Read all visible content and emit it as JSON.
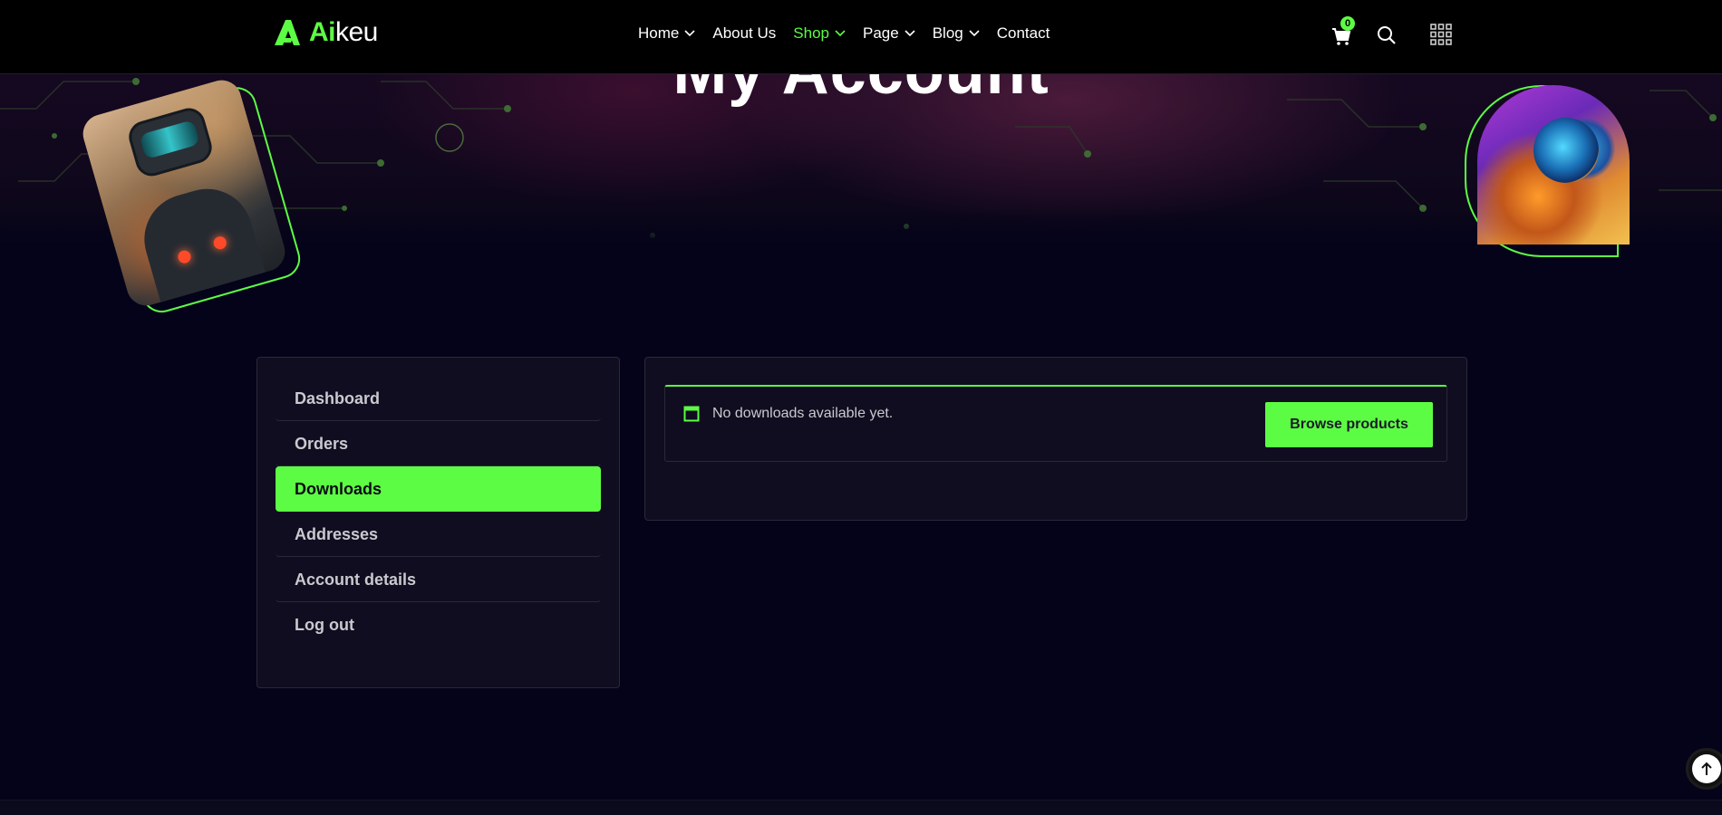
{
  "brand": {
    "logo_accent": "Ai",
    "logo_rest": "keu",
    "accent_color": "#5dfc44"
  },
  "hero": {
    "title": "My Account"
  },
  "nav": {
    "items": [
      {
        "label": "Home",
        "has_dropdown": true,
        "active": false
      },
      {
        "label": "About Us",
        "has_dropdown": false,
        "active": false
      },
      {
        "label": "Shop",
        "has_dropdown": true,
        "active": true
      },
      {
        "label": "Page",
        "has_dropdown": true,
        "active": false
      },
      {
        "label": "Blog",
        "has_dropdown": true,
        "active": false
      },
      {
        "label": "Contact",
        "has_dropdown": false,
        "active": false
      }
    ],
    "cart_count": "0",
    "icons": [
      "cart-icon",
      "search-icon",
      "grid-menu-icon"
    ]
  },
  "account": {
    "menu": [
      {
        "label": "Dashboard",
        "active": false
      },
      {
        "label": "Orders",
        "active": false
      },
      {
        "label": "Downloads",
        "active": true
      },
      {
        "label": "Addresses",
        "active": false
      },
      {
        "label": "Account details",
        "active": false
      },
      {
        "label": "Log out",
        "active": false
      }
    ],
    "notice": {
      "message": "No downloads available yet.",
      "button_label": "Browse products",
      "icon": "notice-window-icon"
    }
  },
  "scroll_top": {
    "icon": "arrow-up-icon"
  }
}
